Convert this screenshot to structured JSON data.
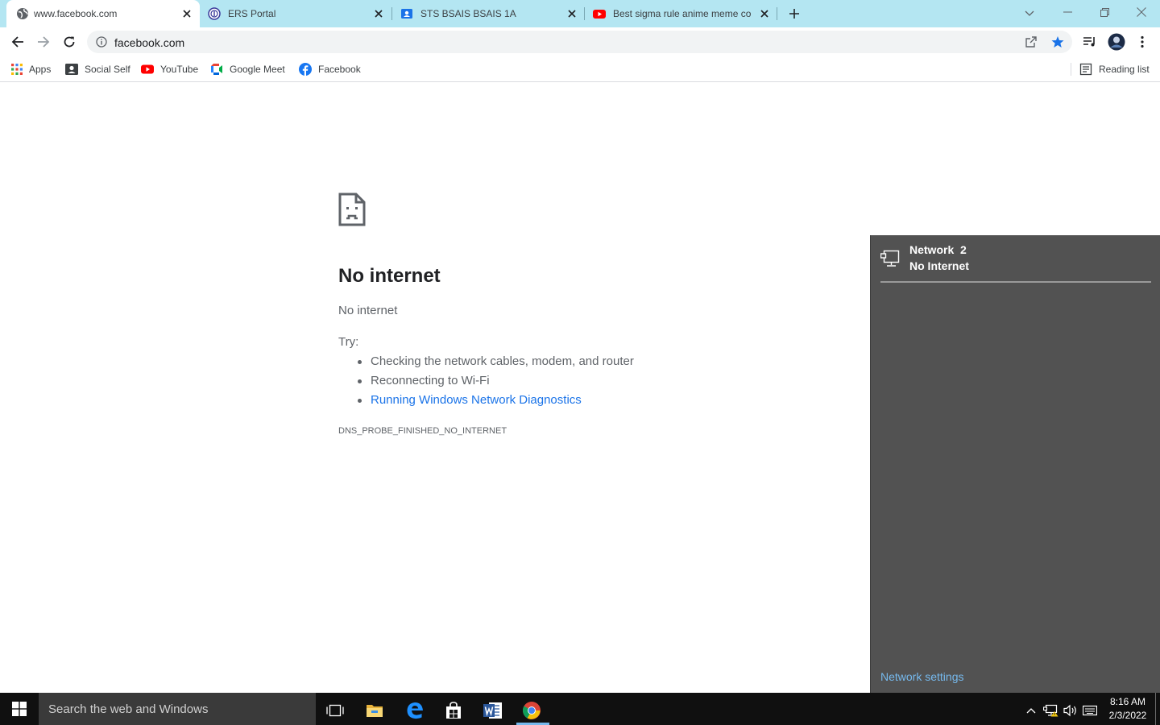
{
  "browser": {
    "tabs": [
      {
        "title": "www.facebook.com",
        "favicon": "globe-icon",
        "active": true
      },
      {
        "title": "ERS Portal",
        "favicon": "ers-logo-icon",
        "active": false
      },
      {
        "title": "STS BSAIS BSAIS 1A",
        "favicon": "classroom-icon",
        "active": false
      },
      {
        "title": "Best sigma rule anime meme cor",
        "favicon": "youtube-icon",
        "active": false
      }
    ],
    "address": "facebook.com",
    "bookmarks": [
      {
        "label": "Apps",
        "icon": "apps-grid-icon"
      },
      {
        "label": "Social Self",
        "icon": "contact-card-icon"
      },
      {
        "label": "YouTube",
        "icon": "youtube-icon"
      },
      {
        "label": "Google Meet",
        "icon": "google-meet-icon"
      },
      {
        "label": "Facebook",
        "icon": "facebook-icon"
      }
    ],
    "reading_list": "Reading list"
  },
  "error_page": {
    "title": "No internet",
    "subtitle": "No internet",
    "try_label": "Try:",
    "suggestions": [
      "Checking the network cables, modem, and router",
      "Reconnecting to Wi-Fi",
      "Running Windows Network Diagnostics"
    ],
    "error_code": "DNS_PROBE_FINISHED_NO_INTERNET"
  },
  "network_flyout": {
    "network_name": "Network  2",
    "status": "No Internet",
    "settings_link": "Network settings"
  },
  "taskbar": {
    "search_placeholder": "Search the web and Windows",
    "time": "8:16 AM",
    "date": "2/3/2022"
  },
  "colors": {
    "tabstrip": "#b4e6f2",
    "link": "#1a73e8",
    "flyout_bg": "#525252",
    "flyout_link": "#76b9ed",
    "taskbar": "#101010"
  }
}
